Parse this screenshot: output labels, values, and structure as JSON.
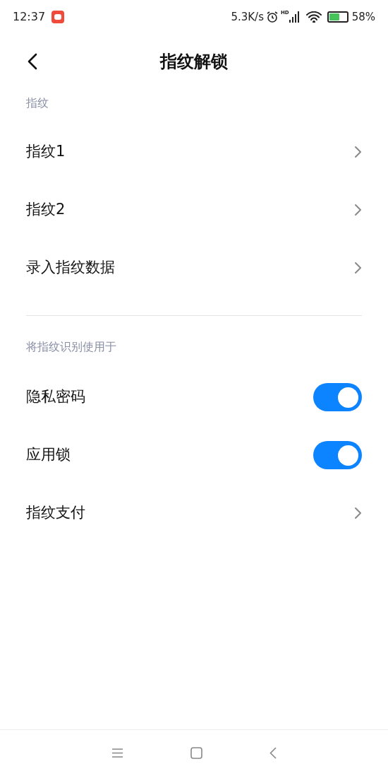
{
  "status_bar": {
    "time": "12:37",
    "speed": "5.3K/s",
    "network": "HD",
    "battery": "58%"
  },
  "header": {
    "title": "指纹解锁"
  },
  "sections": [
    {
      "label": "指纹",
      "items": [
        {
          "kind": "link",
          "label": "指纹1"
        },
        {
          "kind": "link",
          "label": "指纹2"
        },
        {
          "kind": "link",
          "label": "录入指纹数据"
        }
      ]
    },
    {
      "label": "将指纹识别使用于",
      "items": [
        {
          "kind": "toggle",
          "label": "隐私密码",
          "on": true
        },
        {
          "kind": "toggle",
          "label": "应用锁",
          "on": true
        },
        {
          "kind": "link",
          "label": "指纹支付"
        }
      ]
    }
  ]
}
